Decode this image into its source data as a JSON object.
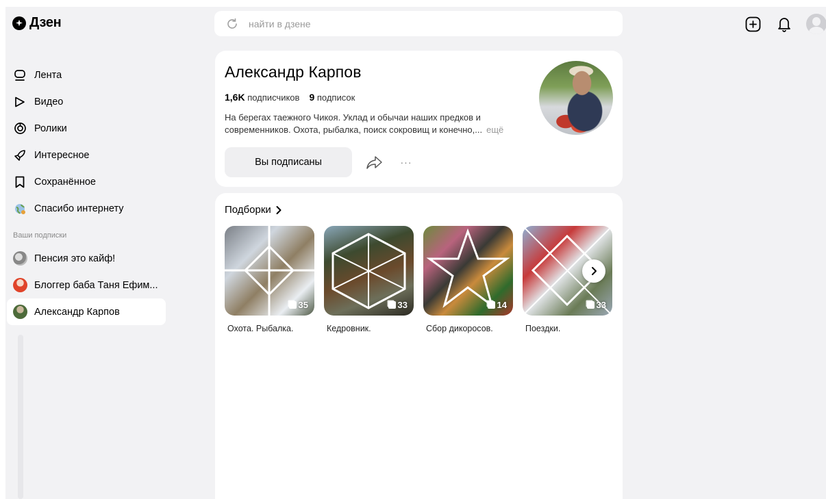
{
  "brand": {
    "name": "Дзен"
  },
  "search": {
    "placeholder": "найти в дзене"
  },
  "nav": {
    "items": [
      {
        "label": "Лента",
        "icon": "feed-icon"
      },
      {
        "label": "Видео",
        "icon": "play-icon"
      },
      {
        "label": "Ролики",
        "icon": "shorts-icon"
      },
      {
        "label": "Интересное",
        "icon": "rocket-icon"
      },
      {
        "label": "Сохранённое",
        "icon": "bookmark-icon"
      },
      {
        "label": "Спасибо интернету",
        "icon": "globe-icon"
      }
    ],
    "subscriptions_heading": "Ваши подписки",
    "subscriptions": [
      {
        "label": "Пенсия это кайф!"
      },
      {
        "label": "Блоггер баба Таня Ефим..."
      },
      {
        "label": "Александр Карпов"
      }
    ]
  },
  "profile": {
    "name": "Александр Карпов",
    "subscribers_count": "1,6K",
    "subscribers_label": "подписчиков",
    "subscriptions_count": "9",
    "subscriptions_label": "подписок",
    "description": "На берегах таежного Чикоя. Уклад и обычаи наших предков и современников. Охота, рыбалка, поиск сокровищ и конечно,...",
    "more_label": "ещё",
    "subscribed_button": "Вы подписаны",
    "more_dots": "···"
  },
  "collections": {
    "title": "Подборки",
    "items": [
      {
        "label": "Охота. Рыбалка.",
        "count": "35"
      },
      {
        "label": "Кедровник.",
        "count": "33"
      },
      {
        "label": "Сбор дикоросов.",
        "count": "14"
      },
      {
        "label": "Поездки.",
        "count": "33"
      }
    ]
  },
  "colors": {
    "background": "#f2f2f4",
    "card": "#ffffff",
    "button": "#efeff1",
    "muted": "#9a9a9a"
  }
}
